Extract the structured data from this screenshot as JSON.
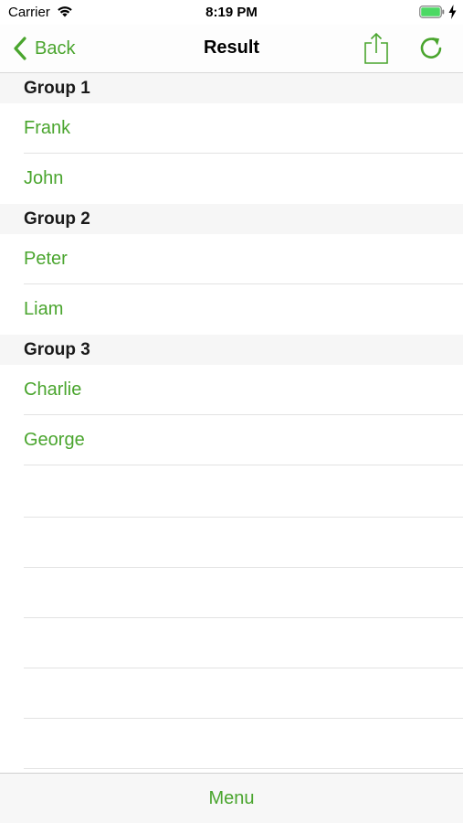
{
  "status_bar": {
    "carrier": "Carrier",
    "time": "8:19 PM",
    "battery_color": "#4cd964"
  },
  "nav": {
    "back_label": "Back",
    "title": "Result",
    "share_icon": "share-icon",
    "refresh_icon": "refresh-icon"
  },
  "accent_color": "#4aa52e",
  "groups": [
    {
      "title": "Group 1",
      "members": [
        "Frank",
        "John"
      ]
    },
    {
      "title": "Group 2",
      "members": [
        "Peter",
        "Liam"
      ]
    },
    {
      "title": "Group 3",
      "members": [
        "Charlie",
        "George"
      ]
    }
  ],
  "toolbar": {
    "menu_label": "Menu"
  }
}
